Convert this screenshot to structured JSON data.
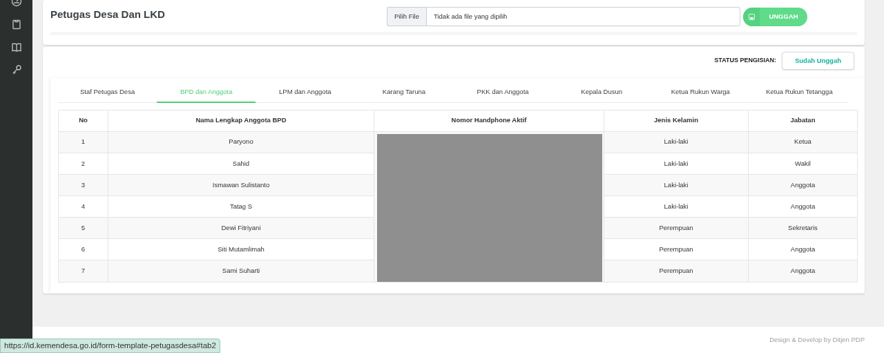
{
  "sidebar": {
    "items": [
      {
        "kind": "gauge"
      },
      {
        "kind": "clipboard"
      },
      {
        "kind": "book"
      },
      {
        "kind": "key"
      }
    ]
  },
  "upload_card": {
    "title": "Petugas Desa Dan LKD",
    "file_button": "Pilih File",
    "file_status": "Tidak ada file yang dipilih",
    "upload_button": "UNGGAH"
  },
  "status": {
    "label": "STATUS PENGISIAN:",
    "value": "Sudah Unggah"
  },
  "tabs": [
    {
      "label": "Staf Petugas Desa",
      "selected": false
    },
    {
      "label": "BPD dan Anggota",
      "selected": true
    },
    {
      "label": "LPM dan Anggota",
      "selected": false
    },
    {
      "label": "Karang Taruna",
      "selected": false
    },
    {
      "label": "PKK dan Anggota",
      "selected": false
    },
    {
      "label": "Kepala Dusun",
      "selected": false
    },
    {
      "label": "Ketua Rukun Warga",
      "selected": false
    },
    {
      "label": "Ketua Rukun Tetangga",
      "selected": false
    }
  ],
  "table": {
    "columns": [
      "No",
      "Nama Lengkap Anggota BPD",
      "Nomor Handphone Aktif",
      "Jenis Kelamin",
      "Jabatan"
    ],
    "rows": [
      [
        "1",
        "Paryono",
        "",
        "Laki-laki",
        "Ketua"
      ],
      [
        "2",
        "Sahid",
        "",
        "Laki-laki",
        "Wakil"
      ],
      [
        "3",
        "Ismawan Sulistanto",
        "",
        "Laki-laki",
        "Anggota"
      ],
      [
        "4",
        "Tatag S",
        "",
        "Laki-laki",
        "Anggota"
      ],
      [
        "5",
        "Dewi Fitriyani",
        "",
        "Perempuan",
        "Sekretaris"
      ],
      [
        "6",
        "Siti Mutamlimah",
        "",
        "Perempuan",
        "Anggota"
      ],
      [
        "7",
        "Sami Suharti",
        "",
        "Perempuan",
        "Anggota"
      ]
    ]
  },
  "footer": {
    "credit": "Design & Develop by Ditjen PDP"
  },
  "status_bar": {
    "url": "https://id.kemendesa.go.id/form-template-petugasdesa#tab2"
  }
}
